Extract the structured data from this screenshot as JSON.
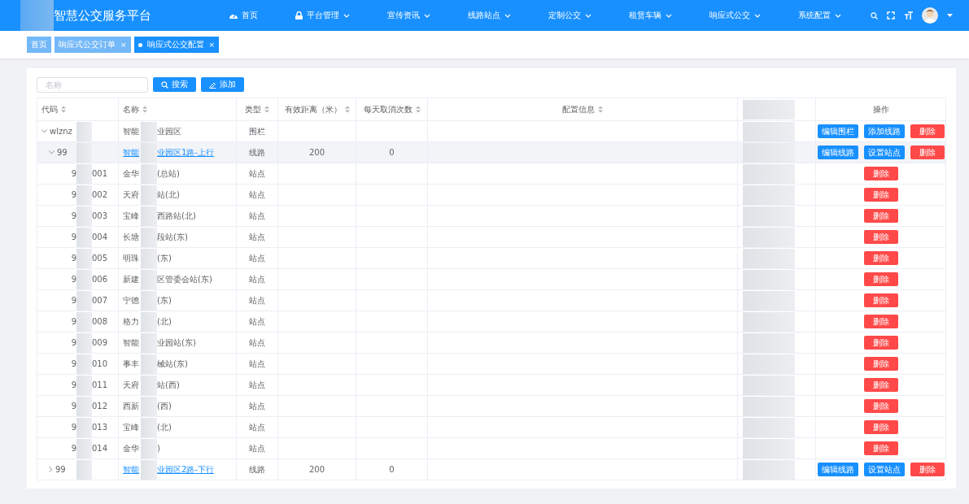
{
  "header": {
    "title": "智慧公交服务平台",
    "nav": [
      {
        "label": "首页",
        "has_menu": false
      },
      {
        "label": "平台管理",
        "has_menu": true
      },
      {
        "label": "宣传资讯",
        "has_menu": true
      },
      {
        "label": "线路站点",
        "has_menu": true
      },
      {
        "label": "定制公交",
        "has_menu": true
      },
      {
        "label": "租赁车辆",
        "has_menu": true
      },
      {
        "label": "响应式公交",
        "has_menu": true
      },
      {
        "label": "系统配置",
        "has_menu": true
      }
    ]
  },
  "tabs": [
    {
      "label": "首页",
      "selected": false,
      "closable": false
    },
    {
      "label": "响应式公交订单",
      "selected": false,
      "closable": true,
      "close": "×"
    },
    {
      "label": "响应式公交配置",
      "selected": true,
      "closable": true,
      "close": "×"
    }
  ],
  "search": {
    "placeholder": "名称"
  },
  "buttons": [
    {
      "label": "搜索"
    },
    {
      "label": "添加"
    }
  ],
  "table": {
    "columns": [
      {
        "label": "代码",
        "sortable": true
      },
      {
        "label": "名称",
        "sortable": true
      },
      {
        "label": "类型",
        "sortable": true
      },
      {
        "label": "有效距离（米）",
        "sortable": true
      },
      {
        "label": "每天取消次数",
        "sortable": true
      },
      {
        "label": "配置信息",
        "sortable": true
      },
      {
        "sortable": false
      },
      {
        "label": "操作",
        "sortable": false
      }
    ],
    "rows": [
      {
        "code_start": "wlznz",
        "name_start": "智能",
        "name_end": "业园区",
        "link": false,
        "type": "围栏",
        "expanded": true,
        "highlighted": false,
        "actions": [
          {
            "label": "编辑围栏",
            "kind": "primary"
          },
          {
            "label": "添加线路",
            "kind": "primary"
          },
          {
            "label": "删除",
            "kind": "danger"
          }
        ],
        "children": [
          {
            "code_start": "99",
            "name_start": "智能",
            "name_end": "业园区1路-上行",
            "link": true,
            "type": "线路",
            "distance": "200",
            "cancel_count": "0",
            "expanded": true,
            "highlighted": true,
            "actions": [
              {
                "label": "编辑线路",
                "kind": "primary"
              },
              {
                "label": "设置站点",
                "kind": "primary"
              },
              {
                "label": "删除",
                "kind": "danger"
              }
            ],
            "children": [
              {
                "code_start": "9",
                "code_end": "001",
                "name_start": "金华",
                "name_end": "(总站)",
                "link": false,
                "type": "站点",
                "highlighted": false,
                "actions": [
                  {
                    "label": "删除",
                    "kind": "danger"
                  }
                ]
              },
              {
                "code_start": "9",
                "code_end": "002",
                "name_start": "天府",
                "name_end": "站(北)",
                "link": false,
                "type": "站点",
                "highlighted": false,
                "actions": [
                  {
                    "label": "删除",
                    "kind": "danger"
                  }
                ]
              },
              {
                "code_start": "9",
                "code_end": "003",
                "name_start": "宝峰",
                "name_end": "西路站(北)",
                "link": false,
                "type": "站点",
                "highlighted": false,
                "actions": [
                  {
                    "label": "删除",
                    "kind": "danger"
                  }
                ]
              },
              {
                "code_start": "9",
                "code_end": "004",
                "name_start": "长塘",
                "name_end": "段站(东)",
                "link": false,
                "type": "站点",
                "highlighted": false,
                "actions": [
                  {
                    "label": "删除",
                    "kind": "danger"
                  }
                ]
              },
              {
                "code_start": "9",
                "code_end": "005",
                "name_start": "明珠",
                "name_end": "(东)",
                "link": false,
                "type": "站点",
                "highlighted": false,
                "actions": [
                  {
                    "label": "删除",
                    "kind": "danger"
                  }
                ]
              },
              {
                "code_start": "9",
                "code_end": "006",
                "name_start": "新建",
                "name_end": "区管委会站(东)",
                "link": false,
                "type": "站点",
                "highlighted": false,
                "actions": [
                  {
                    "label": "删除",
                    "kind": "danger"
                  }
                ]
              },
              {
                "code_start": "9",
                "code_end": "007",
                "name_start": "宁德",
                "name_end": "(东)",
                "link": false,
                "type": "站点",
                "highlighted": false,
                "actions": [
                  {
                    "label": "删除",
                    "kind": "danger"
                  }
                ]
              },
              {
                "code_start": "9",
                "code_end": "008",
                "name_start": "格力",
                "name_end": "(北)",
                "link": false,
                "type": "站点",
                "highlighted": false,
                "actions": [
                  {
                    "label": "删除",
                    "kind": "danger"
                  }
                ]
              },
              {
                "code_start": "9",
                "code_end": "009",
                "name_start": "智能",
                "name_end": "业园站(东)",
                "link": false,
                "type": "站点",
                "highlighted": false,
                "actions": [
                  {
                    "label": "删除",
                    "kind": "danger"
                  }
                ]
              },
              {
                "code_start": "9",
                "code_end": "010",
                "name_start": "事丰",
                "name_end": "械站(东)",
                "link": false,
                "type": "站点",
                "highlighted": false,
                "actions": [
                  {
                    "label": "删除",
                    "kind": "danger"
                  }
                ]
              },
              {
                "code_start": "9",
                "code_end": "011",
                "name_start": "天府",
                "name_end": "站(西)",
                "link": false,
                "type": "站点",
                "highlighted": false,
                "actions": [
                  {
                    "label": "删除",
                    "kind": "danger"
                  }
                ]
              },
              {
                "code_start": "9",
                "code_end": "012",
                "name_start": "西新",
                "name_end": "(西)",
                "link": false,
                "type": "站点",
                "highlighted": false,
                "actions": [
                  {
                    "label": "删除",
                    "kind": "danger"
                  }
                ]
              },
              {
                "code_start": "9",
                "code_end": "013",
                "name_start": "宝峰",
                "name_end": "(北)",
                "link": false,
                "type": "站点",
                "highlighted": false,
                "actions": [
                  {
                    "label": "删除",
                    "kind": "danger"
                  }
                ]
              },
              {
                "code_start": "9",
                "code_end": "014",
                "name_start": "金华",
                "name_end": ")",
                "link": false,
                "type": "站点",
                "highlighted": false,
                "actions": [
                  {
                    "label": "删除",
                    "kind": "danger"
                  }
                ]
              }
            ]
          },
          {
            "code_start": "99",
            "name_start": "智能",
            "name_end": "业园区2路-下行",
            "link": true,
            "type": "线路",
            "distance": "200",
            "cancel_count": "0",
            "expanded": false,
            "highlighted": false,
            "actions": [
              {
                "label": "编辑线路",
                "kind": "primary"
              },
              {
                "label": "设置站点",
                "kind": "primary"
              },
              {
                "label": "删除",
                "kind": "danger"
              }
            ]
          }
        ]
      }
    ]
  }
}
